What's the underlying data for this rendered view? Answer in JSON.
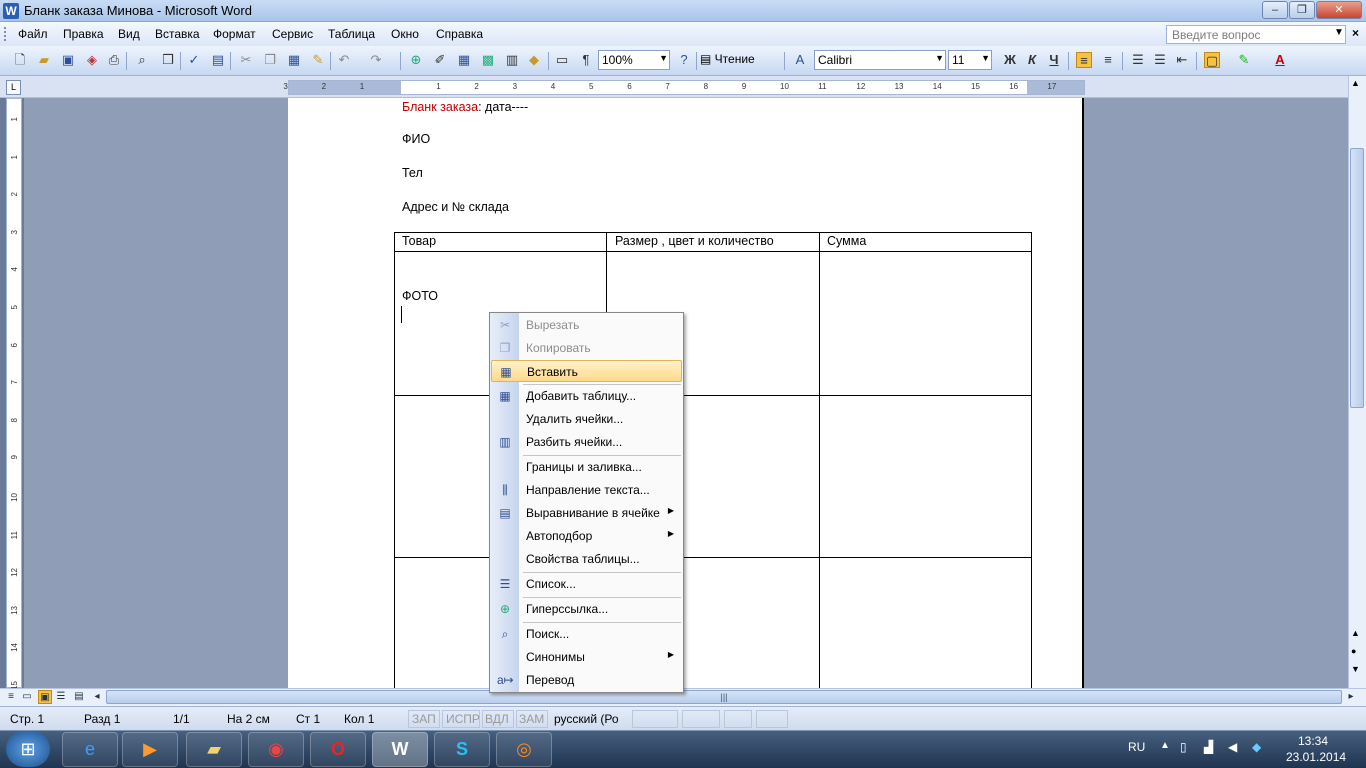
{
  "window": {
    "title": "Бланк заказа Минова - Microsoft Word",
    "app_icon": "word-icon",
    "min_label": "‒",
    "max_label": "❐",
    "close_label": "✕"
  },
  "menubar": {
    "items": [
      "Файл",
      "Правка",
      "Вид",
      "Вставка",
      "Формат",
      "Сервис",
      "Таблица",
      "Окно",
      "Справка"
    ],
    "help_placeholder": "Введите вопрос",
    "close_doc_label": "×"
  },
  "toolbar": {
    "zoom": "100%",
    "read_label": "Чтение",
    "font": "Calibri",
    "font_size": "11",
    "bold_label": "Ж",
    "italic_label": "К",
    "underline_label": "Ч",
    "accent_color": "#f5c242"
  },
  "ruler": {
    "corner_label": "L",
    "h_ticks": [
      "3",
      "2",
      "1",
      "1",
      "2",
      "3",
      "4",
      "5",
      "6",
      "7",
      "8",
      "9",
      "10",
      "11",
      "12",
      "13",
      "14",
      "15",
      "16",
      "17"
    ],
    "v_ticks": [
      "1",
      "1",
      "2",
      "3",
      "4",
      "5",
      "6",
      "7",
      "8",
      "9",
      "10",
      "11",
      "12",
      "13",
      "14",
      "15"
    ]
  },
  "document": {
    "heading_red": "Бланк заказа",
    "heading_rest": ": дата----",
    "line_fio": "ФИО",
    "line_tel": "Тел",
    "line_address": "Адрес и № склада",
    "table": {
      "headers": [
        "Товар",
        "Размер , цвет и количество",
        "Сумма"
      ],
      "cell_photo": "ФОТО"
    }
  },
  "context_menu": {
    "items": [
      {
        "label": "Вырезать",
        "icon": "scissors-icon",
        "disabled": true
      },
      {
        "label": "Копировать",
        "icon": "copy-icon",
        "disabled": true
      },
      {
        "label": "Вставить",
        "icon": "paste-icon",
        "highlighted": true
      },
      {
        "label": "Добавить таблицу...",
        "icon": "insert-table-icon"
      },
      {
        "label": "Удалить ячейки...",
        "icon": ""
      },
      {
        "label": "Разбить ячейки...",
        "icon": "split-cells-icon"
      },
      {
        "label": "Границы и заливка...",
        "icon": ""
      },
      {
        "label": "Направление текста...",
        "icon": "text-direction-icon"
      },
      {
        "label": "Выравнивание в ячейке",
        "icon": "cell-align-icon",
        "submenu": true
      },
      {
        "label": "Автоподбор",
        "icon": "",
        "submenu": true
      },
      {
        "label": "Свойства таблицы...",
        "icon": ""
      },
      {
        "label": "Список...",
        "icon": "list-icon"
      },
      {
        "label": "Гиперссылка...",
        "icon": "hyperlink-icon"
      },
      {
        "label": "Поиск...",
        "icon": "research-icon"
      },
      {
        "label": "Синонимы",
        "icon": "",
        "submenu": true
      },
      {
        "label": "Перевод",
        "icon": "translate-icon"
      }
    ]
  },
  "statusbar": {
    "page": "Стр.  1",
    "section": "Разд  1",
    "pages": "1/1",
    "at": "На  2 см",
    "line": "Ст  1",
    "col": "Кол  1",
    "rec": "ЗАП",
    "trk": "ИСПР",
    "ext": "ВДЛ",
    "ovr": "ЗАМ",
    "language": "русский (Ро"
  },
  "taskbar": {
    "apps": [
      "ie-icon",
      "media-player-icon",
      "explorer-icon",
      "chrome-icon",
      "opera-icon",
      "word-icon",
      "skype-icon",
      "firefox-icon"
    ],
    "lang": "RU",
    "time": "13:34",
    "date": "23.01.2014"
  }
}
